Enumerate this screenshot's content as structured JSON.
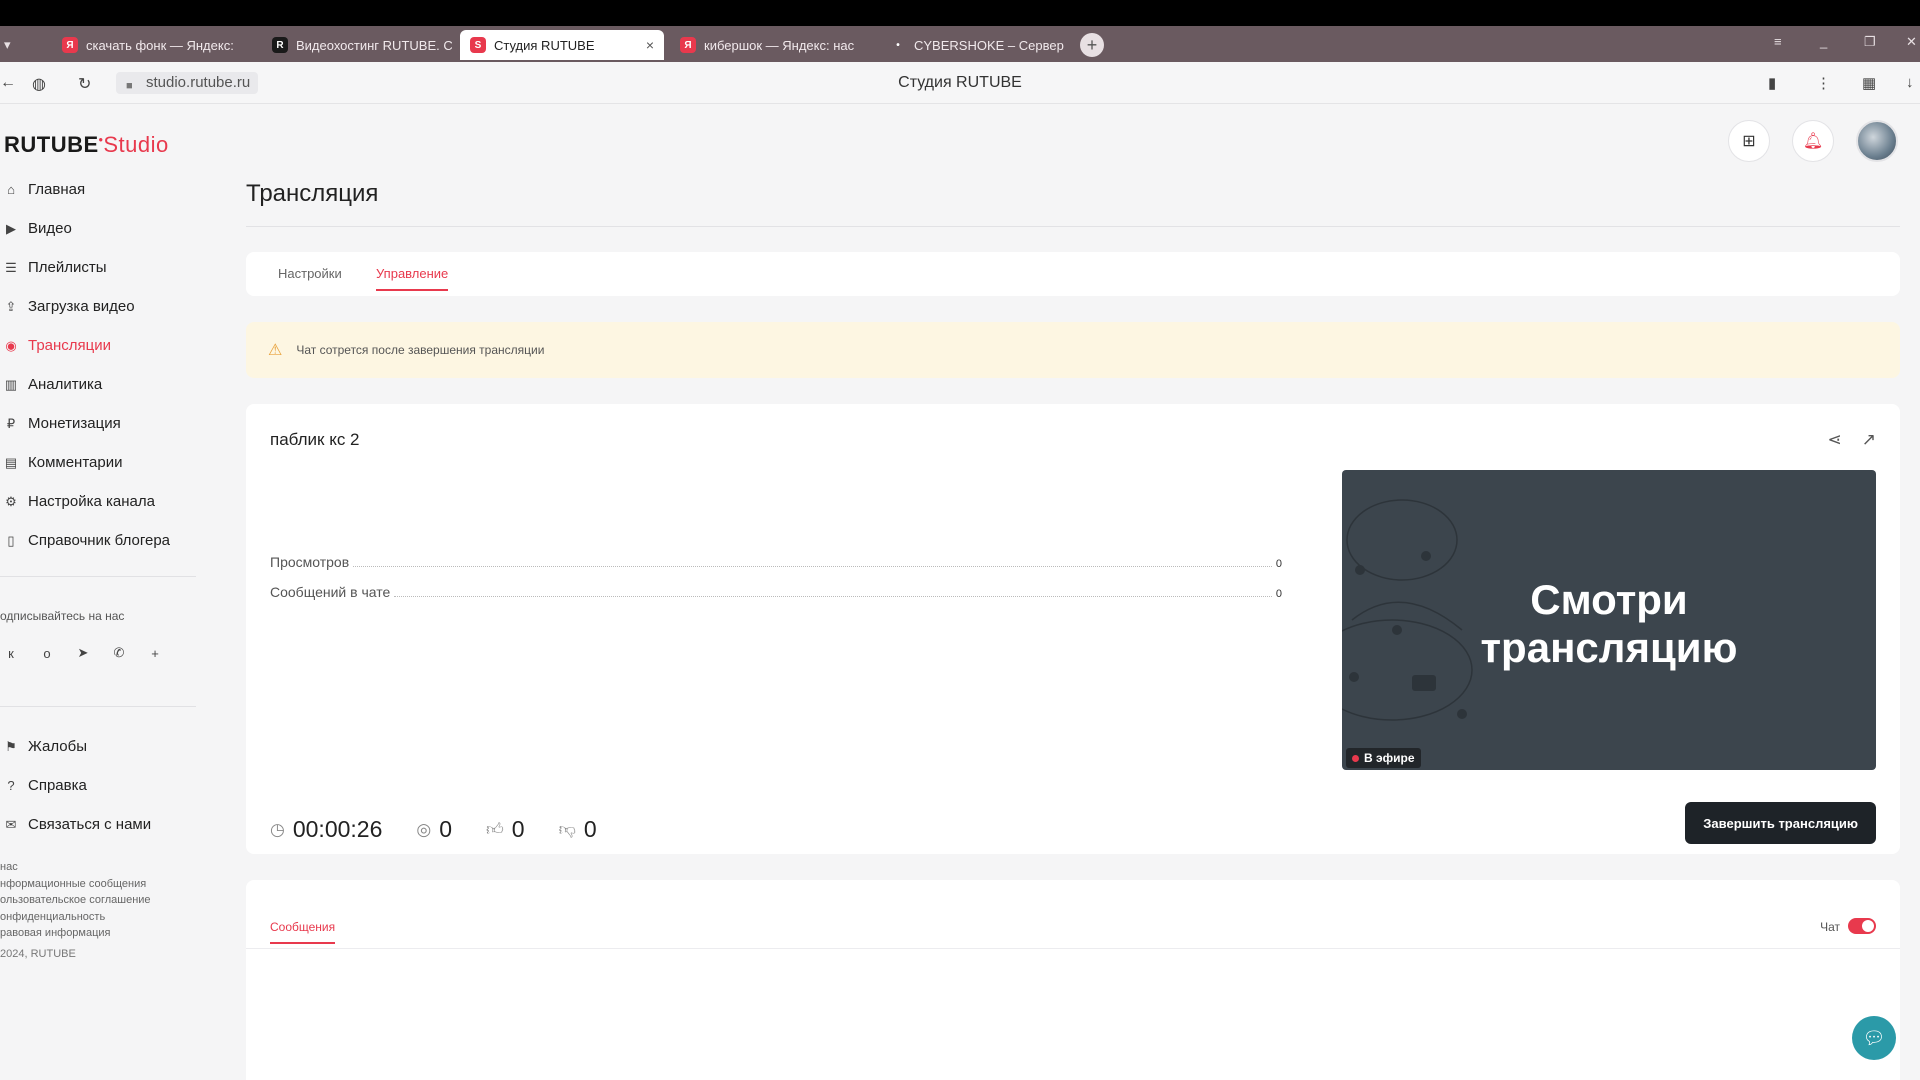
{
  "browser": {
    "tabs": [
      {
        "label": "скачать фонк — Яндекс:",
        "favicon": "Я",
        "color": "#e8394d"
      },
      {
        "label": "Видеохостинг RUTUBE. С",
        "favicon": "R",
        "color": "#1a1a1a"
      },
      {
        "label": "Студия RUTUBE",
        "favicon": "S",
        "color": "#e8394d",
        "close": "×"
      },
      {
        "label": "кибершок — Яндекс: нас",
        "favicon": "Я",
        "color": "#e8394d"
      },
      {
        "label": "CYBERSHOKE – Сервер",
        "favicon": "•",
        "color": "transparent"
      }
    ],
    "new_tab": "+",
    "url": "studio.rutube.ru",
    "page_title": "Студия RUTUBE"
  },
  "app": {
    "logo_main": "RUTUBE",
    "logo_studio": "Studio",
    "nav": [
      {
        "label": "Главная",
        "icon": "home-icon",
        "glyph": "⌂"
      },
      {
        "label": "Видео",
        "icon": "video-icon",
        "glyph": "▶"
      },
      {
        "label": "Плейлисты",
        "icon": "playlist-icon",
        "glyph": "☰"
      },
      {
        "label": "Загрузка видео",
        "icon": "upload-icon",
        "glyph": "⇪"
      },
      {
        "label": "Трансляции",
        "icon": "broadcast-icon",
        "glyph": "◉"
      },
      {
        "label": "Аналитика",
        "icon": "analytics-icon",
        "glyph": "▥"
      },
      {
        "label": "Монетизация",
        "icon": "monetization-icon",
        "glyph": "₽"
      },
      {
        "label": "Комментарии",
        "icon": "comments-icon",
        "glyph": "▤"
      },
      {
        "label": "Настройка канала",
        "icon": "settings-icon",
        "glyph": "⚙"
      },
      {
        "label": "Справочник блогера",
        "icon": "book-icon",
        "glyph": "▯"
      }
    ],
    "social_title": "одписывайтесь на нас",
    "social": [
      "vk-icon",
      "ok-icon",
      "telegram-icon",
      "viber-icon",
      "plus-icon"
    ],
    "nav2": [
      {
        "label": "Жалобы",
        "icon": "complaints-icon",
        "glyph": "⚑"
      },
      {
        "label": "Справка",
        "icon": "help-icon",
        "glyph": "?"
      },
      {
        "label": "Связаться с нами",
        "icon": "contact-icon",
        "glyph": "✉"
      }
    ],
    "footer_links": [
      "нас",
      "нформационные сообщения",
      "ользовательское соглашение",
      "онфиденциальность",
      "равовая информация"
    ],
    "copyright": "2024, RUTUBE"
  },
  "main": {
    "title": "Трансляция",
    "tabs": [
      "Настройки",
      "Управление"
    ],
    "active_tab": 1,
    "alert": "Чат сотрется после завершения трансляции",
    "stream": {
      "name": "паблик кс 2",
      "stats": [
        {
          "label": "Просмотров",
          "value": "0"
        },
        {
          "label": "Сообщений в чате",
          "value": "0"
        }
      ],
      "preview_line1": "Смотри",
      "preview_line2": "трансляцию",
      "live_badge": "В эфире",
      "duration": "00:00:26",
      "viewers": "0",
      "likes": "0",
      "dislikes": "0",
      "end_button": "Завершить трансляцию"
    },
    "chat": {
      "tab": "Сообщения",
      "toggle_label": "Чат",
      "enabled": true
    }
  },
  "colors": {
    "accent": "#e8394d",
    "dark_button": "#1e2328",
    "preview_bg": "#3c454d",
    "alert_bg": "#fdf6e2"
  }
}
